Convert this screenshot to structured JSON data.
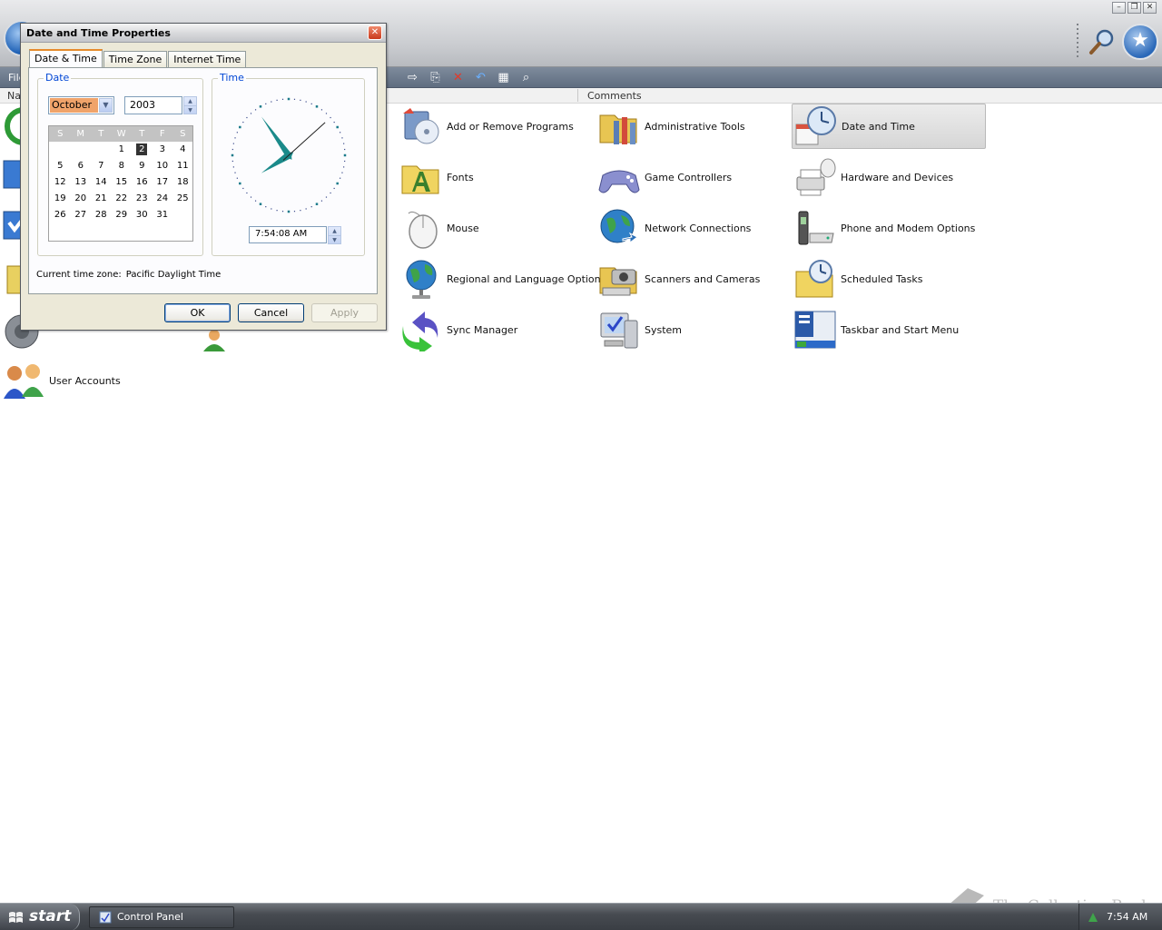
{
  "explorer": {
    "toolbar_file_label": "File",
    "column_name": "Name",
    "column_comments": "Comments"
  },
  "control_panel": {
    "items": [
      {
        "label": "Add or Remove Programs",
        "icon": "add-remove-programs-icon"
      },
      {
        "label": "Administrative Tools",
        "icon": "administrative-tools-icon"
      },
      {
        "label": "Date and Time",
        "icon": "date-time-icon",
        "selected": true
      },
      {
        "label": "Fonts",
        "icon": "fonts-folder-icon"
      },
      {
        "label": "Game Controllers",
        "icon": "game-controller-icon"
      },
      {
        "label": "Hardware and Devices",
        "icon": "hardware-icon"
      },
      {
        "label": "Mouse",
        "icon": "mouse-icon"
      },
      {
        "label": "Network Connections",
        "icon": "network-globe-icon"
      },
      {
        "label": "Phone and Modem Options",
        "icon": "phone-modem-icon"
      },
      {
        "label": "Regional and Language Options",
        "icon": "regional-globe-icon"
      },
      {
        "label": "Scanners and Cameras",
        "icon": "scanner-camera-icon"
      },
      {
        "label": "Scheduled Tasks",
        "icon": "scheduled-tasks-icon"
      },
      {
        "label": "Sync Manager",
        "icon": "sync-manager-icon"
      },
      {
        "label": "System",
        "icon": "system-icon"
      },
      {
        "label": "Taskbar and Start Menu",
        "icon": "taskbar-start-icon"
      },
      {
        "label": "User Accounts",
        "icon": "user-accounts-icon"
      }
    ]
  },
  "dialog": {
    "title": "Date and Time Properties",
    "tabs": [
      "Date & Time",
      "Time Zone",
      "Internet Time"
    ],
    "active_tab": "Date & Time",
    "date_group_label": "Date",
    "time_group_label": "Time",
    "month": "October",
    "year": "2003",
    "weekday_headers": [
      "S",
      "M",
      "T",
      "W",
      "T",
      "F",
      "S"
    ],
    "calendar_days": [
      "",
      "",
      "",
      "1",
      "2",
      "3",
      "4",
      "5",
      "6",
      "7",
      "8",
      "9",
      "10",
      "11",
      "12",
      "13",
      "14",
      "15",
      "16",
      "17",
      "18",
      "19",
      "20",
      "21",
      "22",
      "23",
      "24",
      "25",
      "26",
      "27",
      "28",
      "29",
      "30",
      "31"
    ],
    "selected_day": "2",
    "time": "7:54:08 AM",
    "time_zone_label": "Current time zone:",
    "time_zone_value": "Pacific Daylight Time",
    "ok_label": "OK",
    "cancel_label": "Cancel",
    "apply_label": "Apply",
    "clock": {
      "hours": 7,
      "minutes": 54,
      "seconds": 8
    }
  },
  "taskbar": {
    "start_label": "start",
    "task_label": "Control Panel",
    "clock": "7:54 AM"
  },
  "watermark": "The Collection Book",
  "colors": {
    "toolbar": "#6b788a",
    "selected_item": "#dcdcdc",
    "tab_accent": "#e68b2c",
    "clock_hands": "#1a8a8a",
    "group_label": "#0046d5"
  }
}
